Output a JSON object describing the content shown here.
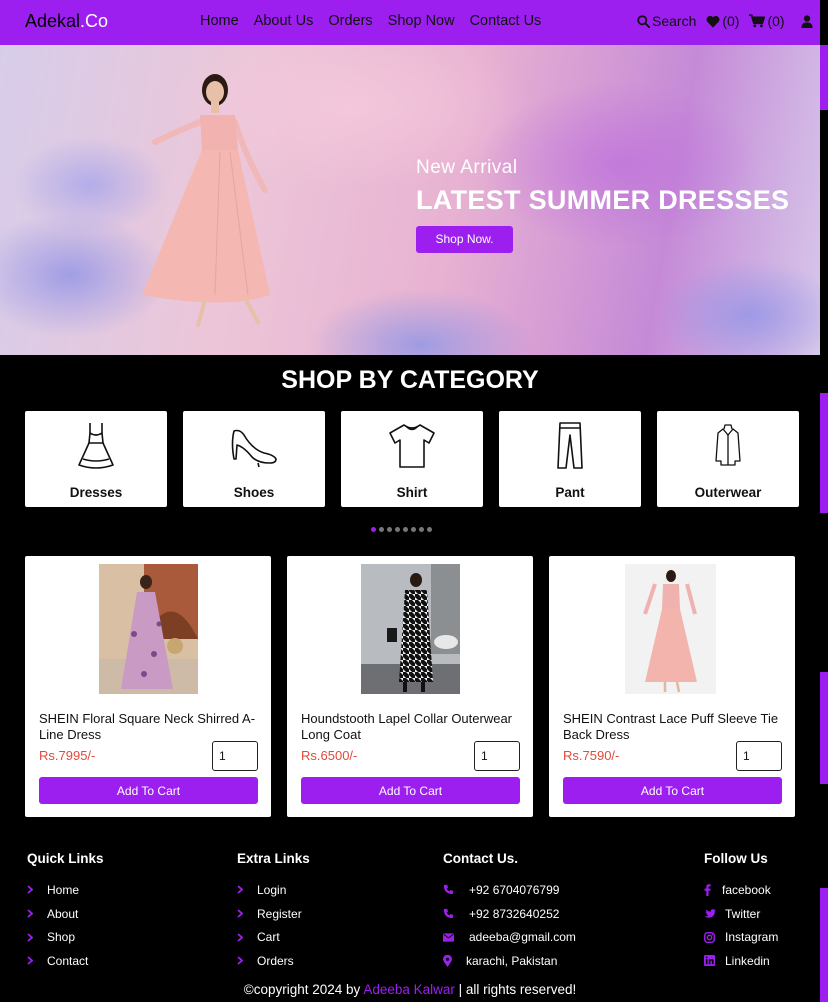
{
  "header": {
    "logo_main": "Adekal",
    "logo_suffix": ".Co",
    "nav": [
      "Home",
      "About Us",
      "Orders",
      "Shop Now",
      "Contact Us"
    ],
    "search_label": "Search",
    "wishlist_count": "(0)",
    "cart_count": "(0)"
  },
  "hero": {
    "subtitle": "New Arrival",
    "title": "LATEST SUMMER DRESSES",
    "button": "Shop Now."
  },
  "categories": {
    "title": "SHOP BY CATEGORY",
    "items": [
      {
        "label": "Dresses",
        "icon": "dress-icon"
      },
      {
        "label": "Shoes",
        "icon": "high-heel-icon"
      },
      {
        "label": "Shirt",
        "icon": "tshirt-icon"
      },
      {
        "label": "Pant",
        "icon": "pants-icon"
      },
      {
        "label": "Outerwear",
        "icon": "coat-icon"
      }
    ],
    "slider_dots": 8,
    "active_dot": 0
  },
  "products": [
    {
      "name": "SHEIN Floral Square Neck Shirred A-Line Dress",
      "price": "Rs.7995/-",
      "qty": "1",
      "button": "Add To Cart"
    },
    {
      "name": "Houndstooth Lapel Collar Outerwear Long Coat",
      "price": "Rs.6500/-",
      "qty": "1",
      "button": "Add To Cart"
    },
    {
      "name": "SHEIN Contrast Lace Puff Sleeve Tie Back Dress",
      "price": "Rs.7590/-",
      "qty": "1",
      "button": "Add To Cart"
    }
  ],
  "footer": {
    "quick_links": {
      "title": "Quick Links",
      "items": [
        "Home",
        "About",
        "Shop",
        "Contact"
      ]
    },
    "extra_links": {
      "title": "Extra Links",
      "items": [
        "Login",
        "Register",
        "Cart",
        "Orders"
      ]
    },
    "contact": {
      "title": "Contact Us.",
      "items": [
        "+92 6704076799",
        "+92 8732640252",
        "adeeba@gmail.com",
        "karachi, Pakistan"
      ]
    },
    "follow": {
      "title": "Follow Us",
      "items": [
        "facebook",
        "Twitter",
        "Instagram",
        "Linkedin"
      ]
    },
    "copyright_prefix": "©copyright 2024 by",
    "copyright_author": "Adeeba Kalwar",
    "copyright_suffix": "| all rights reserved!"
  },
  "colors": {
    "accent": "#9c1ff0",
    "price": "#e24a3b",
    "background": "#000000"
  }
}
